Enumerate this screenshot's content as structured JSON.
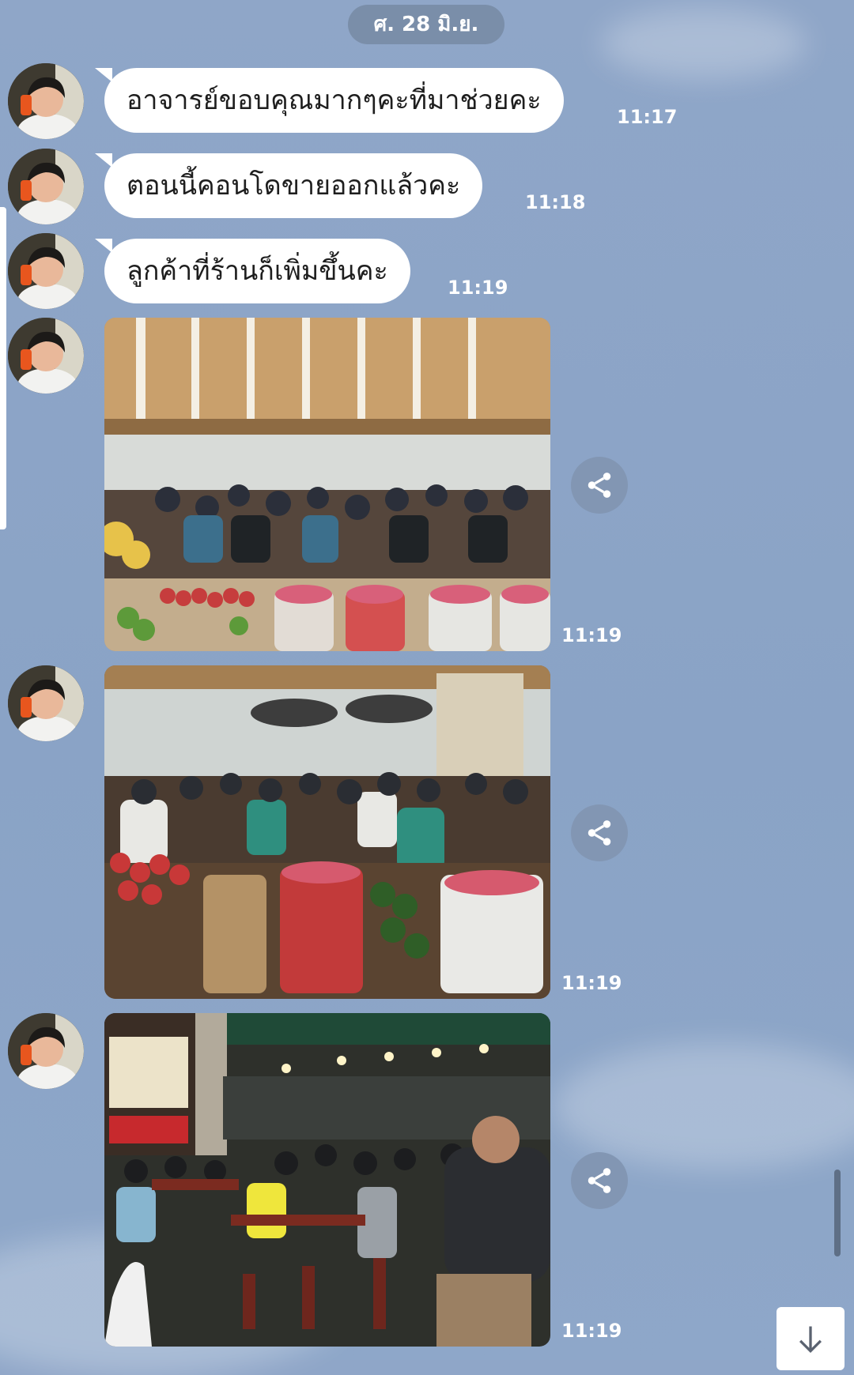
{
  "chat": {
    "date": "ศ. 28 มิ.ย.",
    "messages": [
      {
        "text": "อาจารย์ขอบคุณมากๆคะที่มาช่วยคะ",
        "time": "11:17"
      },
      {
        "text": "ตอนนี้คอนโดขายออกแล้วคะ",
        "time": "11:18"
      },
      {
        "text": "ลูกค้าที่ร้านก็เพิ่มขึ้นคะ",
        "time": "11:19"
      }
    ],
    "photos": [
      {
        "time": "11:19"
      },
      {
        "time": "11:19"
      },
      {
        "time": "11:19"
      }
    ]
  },
  "icons": {
    "share": "share-icon",
    "scroll_down": "arrow-down-icon",
    "avatar": "contact-avatar"
  },
  "colors": {
    "background": "#8fa6c8",
    "bubble": "#ffffff",
    "date_pill": "#7a8ea9",
    "share_button": "#8296b3"
  }
}
